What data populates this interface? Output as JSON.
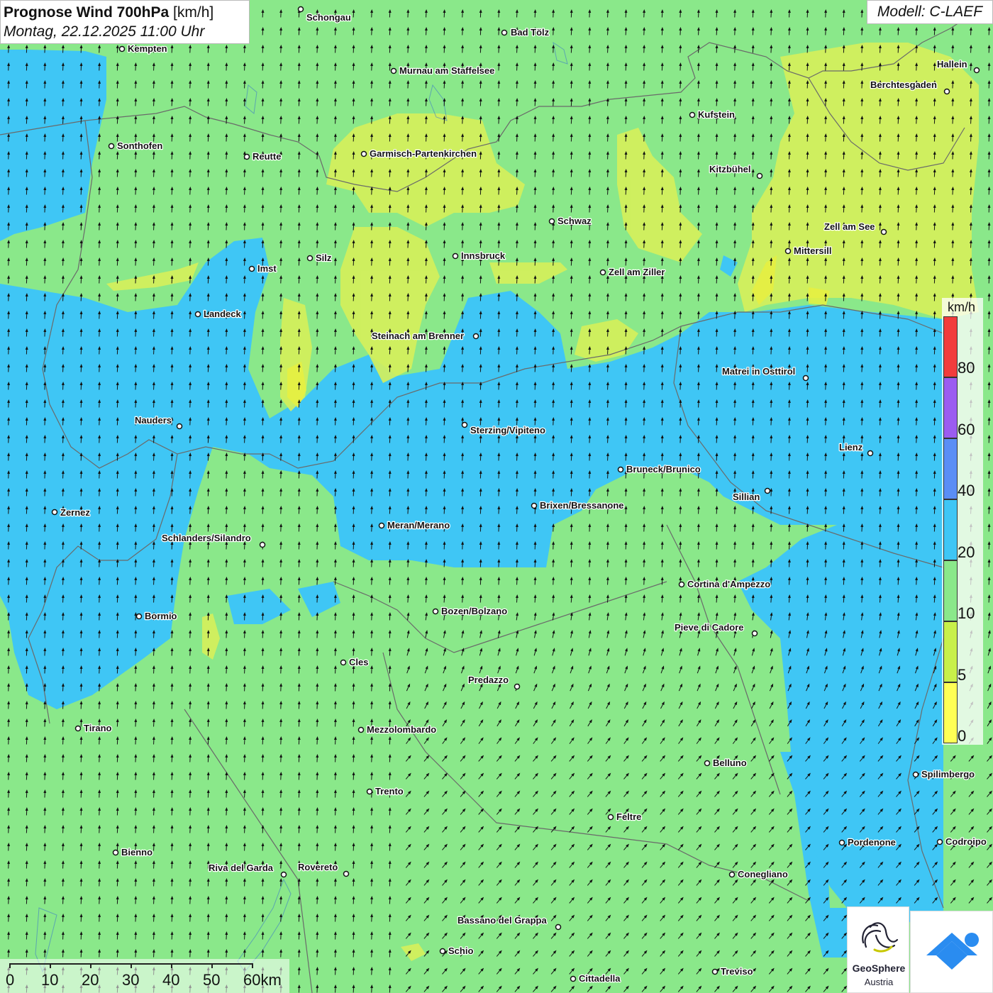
{
  "header": {
    "title": "Prognose Wind 700hPa",
    "title_unit": "[km/h]",
    "subtitle": "Montag, 22.12.2025 11:00 Uhr",
    "model": "Modell: C-LAEF"
  },
  "legend": {
    "unit": "km/h",
    "labels": [
      "0",
      "5",
      "10",
      "20",
      "40",
      "60",
      "80"
    ],
    "colors": [
      "#ffff55",
      "#c8f04a",
      "#8ae88a",
      "#3fc6f5",
      "#5a8ef5",
      "#9b5cf0",
      "#f23c3c"
    ]
  },
  "scale_bar": {
    "labels": [
      "0",
      "10",
      "20",
      "30",
      "40",
      "50",
      "60km"
    ]
  },
  "logo": {
    "name": "GeoSphere",
    "sub": "Austria"
  },
  "colors": {
    "map_green": "#8ae88a",
    "map_blue": "#3fc6f5",
    "map_yellow": "#d6f05a",
    "map_strong_yellow": "#e8f040",
    "border": "#6a6a6a",
    "app_icon": "#2a8cf0"
  },
  "wind": {
    "prevailing_direction": "north",
    "arrow_color": "#111111"
  },
  "cities": [
    {
      "name": "Schongau"
    },
    {
      "name": "Bad Tölz"
    },
    {
      "name": "Kempten"
    },
    {
      "name": "Murnau am Staffelsee"
    },
    {
      "name": "Hallein"
    },
    {
      "name": "Berchtesgaden"
    },
    {
      "name": "Kufstein"
    },
    {
      "name": "Sonthofen"
    },
    {
      "name": "Reutte"
    },
    {
      "name": "Garmisch-Partenkirchen"
    },
    {
      "name": "Kitzbühel"
    },
    {
      "name": "Schwaz"
    },
    {
      "name": "Zell am See"
    },
    {
      "name": "Mittersill"
    },
    {
      "name": "Silz"
    },
    {
      "name": "Innsbruck"
    },
    {
      "name": "Imst"
    },
    {
      "name": "Zell am Ziller"
    },
    {
      "name": "Landeck"
    },
    {
      "name": "Steinach am Brenner"
    },
    {
      "name": "Matrei in Osttirol"
    },
    {
      "name": "Nauders"
    },
    {
      "name": "Sterzing/Vipiteno"
    },
    {
      "name": "Lienz"
    },
    {
      "name": "Bruneck/Brunico"
    },
    {
      "name": "Sillian"
    },
    {
      "name": "Brixen/Bressanone"
    },
    {
      "name": "Zernez"
    },
    {
      "name": "Meran/Merano"
    },
    {
      "name": "Schlanders/Silandro"
    },
    {
      "name": "Cortina d'Ampezzo"
    },
    {
      "name": "Bozen/Bolzano"
    },
    {
      "name": "Bormio"
    },
    {
      "name": "Pieve di Cadore"
    },
    {
      "name": "Cles"
    },
    {
      "name": "Predazzo"
    },
    {
      "name": "Tirano"
    },
    {
      "name": "Mezzolombardo"
    },
    {
      "name": "Belluno"
    },
    {
      "name": "Spilimbergo"
    },
    {
      "name": "Trento"
    },
    {
      "name": "Feltre"
    },
    {
      "name": "Pordenone"
    },
    {
      "name": "Codroipo"
    },
    {
      "name": "Bienno"
    },
    {
      "name": "Riva del Garda"
    },
    {
      "name": "Rovereto"
    },
    {
      "name": "Conegliano"
    },
    {
      "name": "Bassano del Grappa"
    },
    {
      "name": "Schio"
    },
    {
      "name": "Treviso"
    },
    {
      "name": "Cittadella"
    }
  ]
}
